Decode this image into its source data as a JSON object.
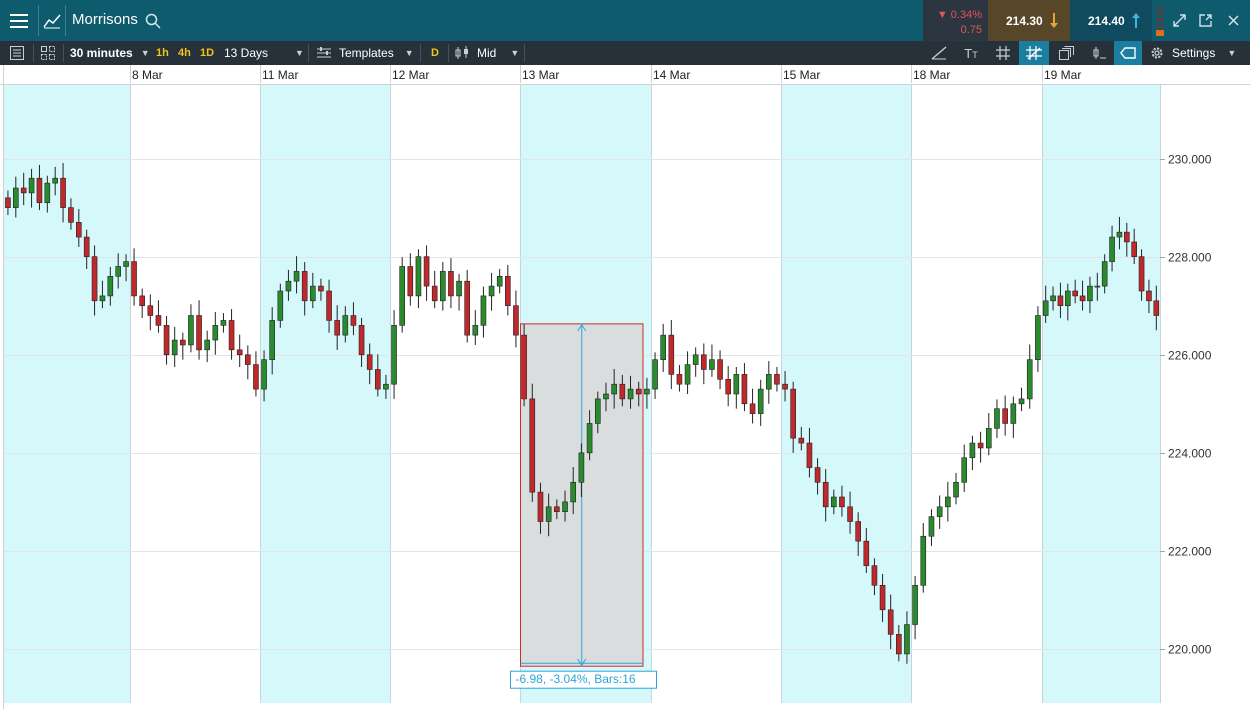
{
  "header": {
    "title": "Morrisons",
    "change_pct": "▼ 0.34%",
    "change_abs": "0.75",
    "sell_price": "214.30",
    "buy_price": "214.40"
  },
  "toolbar": {
    "interval": "30 minutes",
    "quick_1h": "1h",
    "quick_4h": "4h",
    "quick_1d": "1D",
    "range": "13 Days",
    "templates": "Templates",
    "d_label": "D",
    "price_type": "Mid",
    "settings": "Settings"
  },
  "colors": {
    "header": "#0e5b6e",
    "toolbar": "#27313a",
    "band": "#d5f8fa",
    "up": "#2a8a2e",
    "down": "#c0282b",
    "measure": "#2aa7d6"
  },
  "measure_label": "-6.98, -3.04%, Bars:16",
  "chart_data": {
    "type": "candlestick",
    "x_labels": [
      "8 Mar",
      "11 Mar",
      "12 Mar",
      "13 Mar",
      "14 Mar",
      "15 Mar",
      "18 Mar",
      "19 Mar"
    ],
    "y_ticks": [
      "230.000",
      "228.000",
      "226.000",
      "224.000",
      "222.000",
      "220.000"
    ],
    "ylim": [
      218.9,
      231.5
    ],
    "measurement": {
      "change": -6.98,
      "change_pct": -3.04,
      "bars": 16
    },
    "closes": [
      [
        229.0,
        229.4,
        229.3,
        229.6,
        229.1,
        229.5,
        229.6,
        229.0,
        228.7,
        228.4,
        228.0,
        227.1,
        227.2,
        227.6,
        227.8,
        227.9
      ],
      [
        227.2,
        227.0,
        226.8,
        226.6,
        226.0,
        226.3,
        226.2,
        226.8,
        226.1,
        226.3,
        226.6,
        226.7,
        226.1,
        226.0,
        225.8,
        225.3
      ],
      [
        225.9,
        226.7,
        227.3,
        227.5,
        227.7,
        227.1,
        227.4,
        227.3,
        226.7,
        226.4,
        226.8,
        226.6,
        226.0,
        225.7,
        225.3,
        225.4
      ],
      [
        226.6,
        227.8,
        227.2,
        228.0,
        227.4,
        227.1,
        227.7,
        227.2,
        227.5,
        226.4,
        226.6,
        227.2,
        227.4,
        227.6,
        227.0,
        226.4
      ],
      [
        225.1,
        223.2,
        222.6,
        222.9,
        222.8,
        223.0,
        223.4,
        224.0,
        224.6,
        225.1,
        225.2,
        225.4,
        225.1,
        225.3,
        225.2,
        225.3
      ],
      [
        225.9,
        226.4,
        225.6,
        225.4,
        225.8,
        226.0,
        225.7,
        225.9,
        225.5,
        225.2,
        225.6,
        225.0,
        224.8,
        225.3,
        225.6,
        225.4
      ],
      [
        225.3,
        224.3,
        224.2,
        223.7,
        223.4,
        222.9,
        223.1,
        222.9,
        222.6,
        222.2,
        221.7,
        221.3,
        220.8,
        220.3,
        219.9,
        220.5
      ],
      [
        221.3,
        222.3,
        222.7,
        222.9,
        223.1,
        223.4,
        223.9,
        224.2,
        224.1,
        224.5,
        224.9,
        224.6,
        225.0,
        225.1,
        225.9,
        226.8
      ],
      [
        227.1,
        227.2,
        227.0,
        227.3,
        227.2,
        227.1,
        227.4,
        227.4,
        227.9,
        228.4,
        228.5,
        228.3,
        228.0,
        227.3,
        227.1,
        226.8
      ]
    ]
  }
}
